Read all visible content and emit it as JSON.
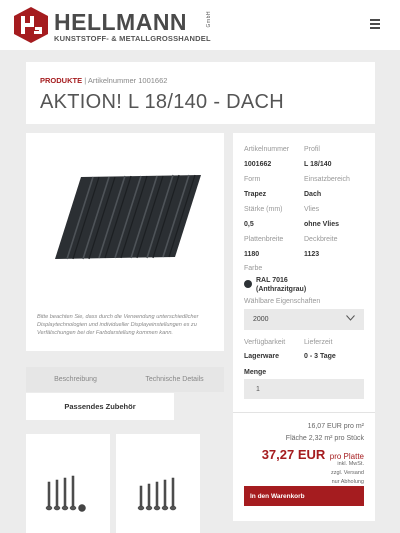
{
  "header": {
    "brand_name": "HELLMANN",
    "brand_suffix": "GmbH",
    "brand_tagline": "KUNSTSTOFF- & METALLGROSSHANDEL",
    "menu_icon": "hamburger-menu-icon"
  },
  "breadcrumb": {
    "category": "PRODUKTE",
    "separator": "|",
    "article_ref": "Artikelnummer 1001662"
  },
  "product": {
    "title": "AKTION! L 18/140 - DACH",
    "image_note": "Bitte beachten Sie, dass durch die Verwendung unterschiedlicher Displaytechnologien und individueller Displayeinstellungen es zu Verfälschungen bei der Farbdarstellung kommen kann."
  },
  "specs": [
    {
      "label": "Artikelnummer",
      "value": "1001662"
    },
    {
      "label": "Profil",
      "value": "L 18/140"
    },
    {
      "label": "Form",
      "value": "Trapez"
    },
    {
      "label": "Einsatzbereich",
      "value": "Dach"
    },
    {
      "label": "Stärke (mm)",
      "value": "0,5"
    },
    {
      "label": "Vlies",
      "value": "ohne Vlies"
    },
    {
      "label": "Plattenbreite",
      "value": "1180"
    },
    {
      "label": "Deckbreite",
      "value": "1123"
    }
  ],
  "color": {
    "label": "Farbe",
    "line1": "RAL 7016",
    "line2": "(Anthrazitgrau)",
    "swatch": "#2d3236"
  },
  "properties": {
    "label": "Wählbare Eigenschaften",
    "selected": "2000"
  },
  "availability": {
    "stock_label": "Verfügbarkeit",
    "stock_value": "Lagerware",
    "delivery_label": "Lieferzeit",
    "delivery_value": "0 - 3 Tage"
  },
  "quantity": {
    "label": "Menge",
    "value": "1"
  },
  "pricing": {
    "unit_price": "16,07 EUR pro m²",
    "area": "Fläche 2,32 m² pro Stück",
    "total_amount": "37,27 EUR",
    "total_unit": "pro Platte",
    "tax_line1": "inkl. MwSt.",
    "tax_line2": "zzgl. Versand",
    "tax_line3": "nur Abholung"
  },
  "cart_button": "In den Warenkorb",
  "tabs": [
    {
      "label": "Beschreibung"
    },
    {
      "label": "Technische Details"
    }
  ],
  "accessories_tab": "Passendes Zubehör",
  "colors": {
    "brand_red": "#a51c1f",
    "background": "#ececec",
    "card": "#ffffff"
  }
}
